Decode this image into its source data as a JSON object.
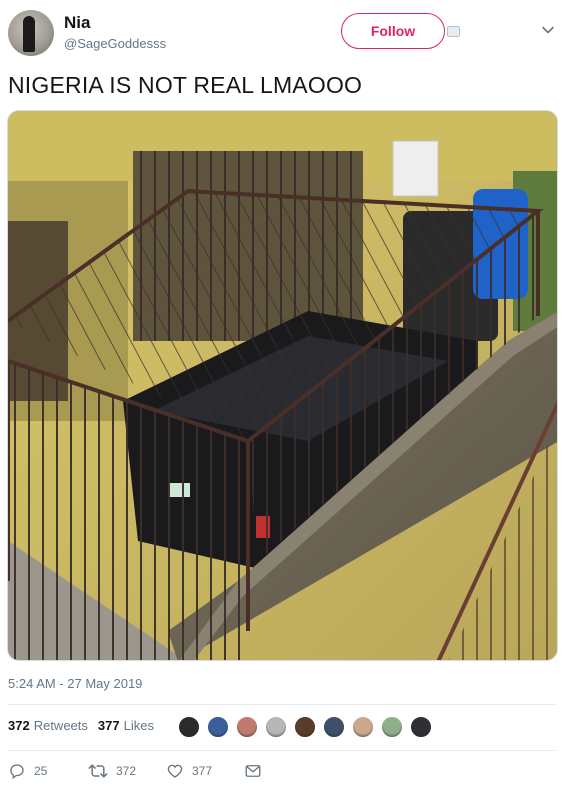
{
  "header": {
    "display_name": "Nia",
    "handle": "@SageGoddesss",
    "follow_label": "Follow"
  },
  "tweet": {
    "text": "NIGERIA IS NOT REAL LMAOOO",
    "timestamp": "5:24 AM - 27 May 2019"
  },
  "stats": {
    "retweets_count": "372",
    "retweets_label": "Retweets",
    "likes_count": "377",
    "likes_label": "Likes"
  },
  "actions": {
    "replies": "25",
    "retweets": "372",
    "likes": "377"
  },
  "colors": {
    "accent": "#e0245e",
    "secondary_text": "#657786",
    "primary_text": "#14171a"
  },
  "icons": [
    "chevron-down-icon",
    "add-icon",
    "reply-icon",
    "retweet-icon",
    "like-icon",
    "message-icon"
  ],
  "liker_colors": [
    "#2b2b2b",
    "#3a5f9a",
    "#c07a70",
    "#b7b7b7",
    "#5a3c2a",
    "#3c4f6b",
    "#c9a88d",
    "#8fae8a",
    "#2f2f35"
  ]
}
